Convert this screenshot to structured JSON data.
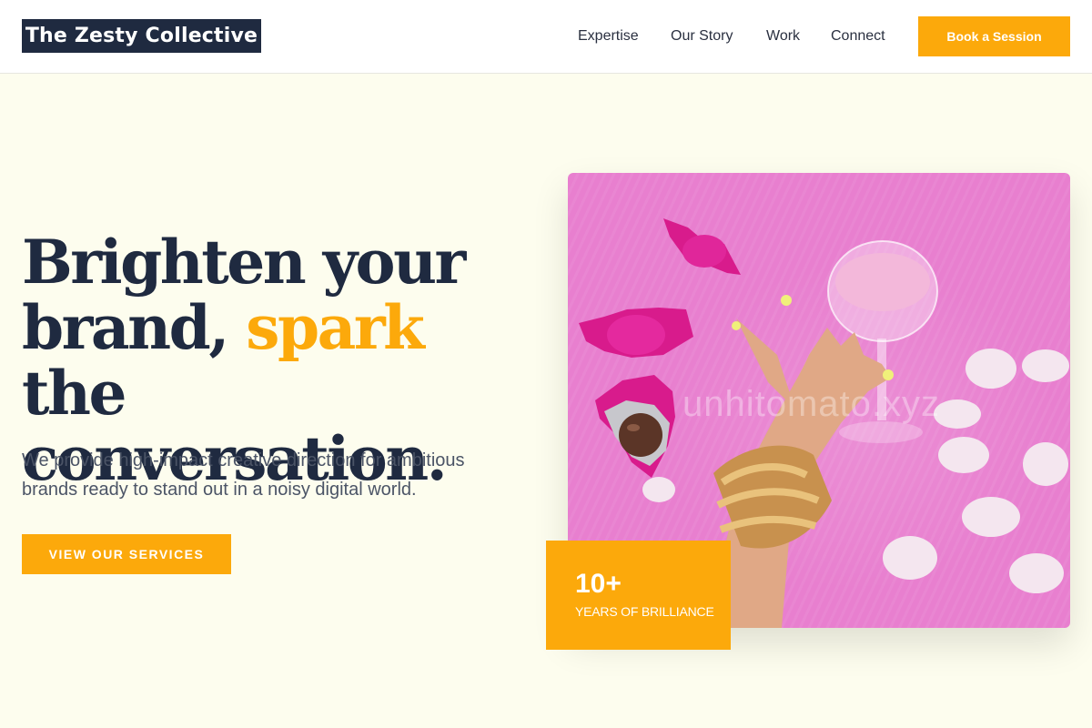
{
  "brand": {
    "name": "The Zesty Collective"
  },
  "nav": {
    "items": [
      {
        "label": "Expertise"
      },
      {
        "label": "Our Story"
      },
      {
        "label": "Work"
      },
      {
        "label": "Connect"
      }
    ],
    "cta_label": "Book a Session"
  },
  "hero": {
    "headline_part1": "Brighten your brand, ",
    "headline_accent": "spark",
    "headline_part2": " the conversation.",
    "subtext": "We provide high-impact creative direction for ambitious brands ready to stand out in a noisy digital world.",
    "button_label": "VIEW OUR SERVICES",
    "image_watermark": "unhitomato.xyz"
  },
  "badge": {
    "number": "10+",
    "label": "YEARS OF BRILLIANCE"
  },
  "colors": {
    "accent": "#fca90b",
    "navy": "#1f2a40",
    "background": "#fdfdee",
    "image_pink": "#e87fcf"
  }
}
